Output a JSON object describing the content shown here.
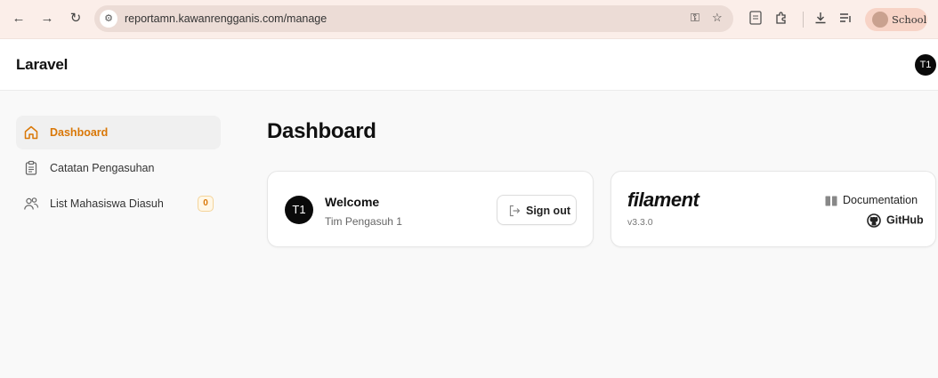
{
  "browser": {
    "url": "reportamn.kawanrengganis.com/manage",
    "profile_label": "School"
  },
  "app": {
    "brand": "Laravel",
    "user_initials": "T1"
  },
  "sidebar": {
    "items": [
      {
        "label": "Dashboard",
        "icon": "home-icon",
        "active": true
      },
      {
        "label": "Catatan Pengasuhan",
        "icon": "clipboard-icon"
      },
      {
        "label": "List Mahasiswa Diasuh",
        "icon": "users-icon",
        "badge": "0"
      }
    ]
  },
  "main": {
    "title": "Dashboard",
    "welcome": {
      "avatar_initials": "T1",
      "title": "Welcome",
      "name": "Tim Pengasuh 1",
      "signout_label": "Sign out"
    },
    "filament": {
      "logo": "filament",
      "version": "v3.3.0",
      "documentation_label": "Documentation",
      "github_label": "GitHub"
    }
  },
  "colors": {
    "accent": "#d97706",
    "chrome": "#fbeee9"
  }
}
